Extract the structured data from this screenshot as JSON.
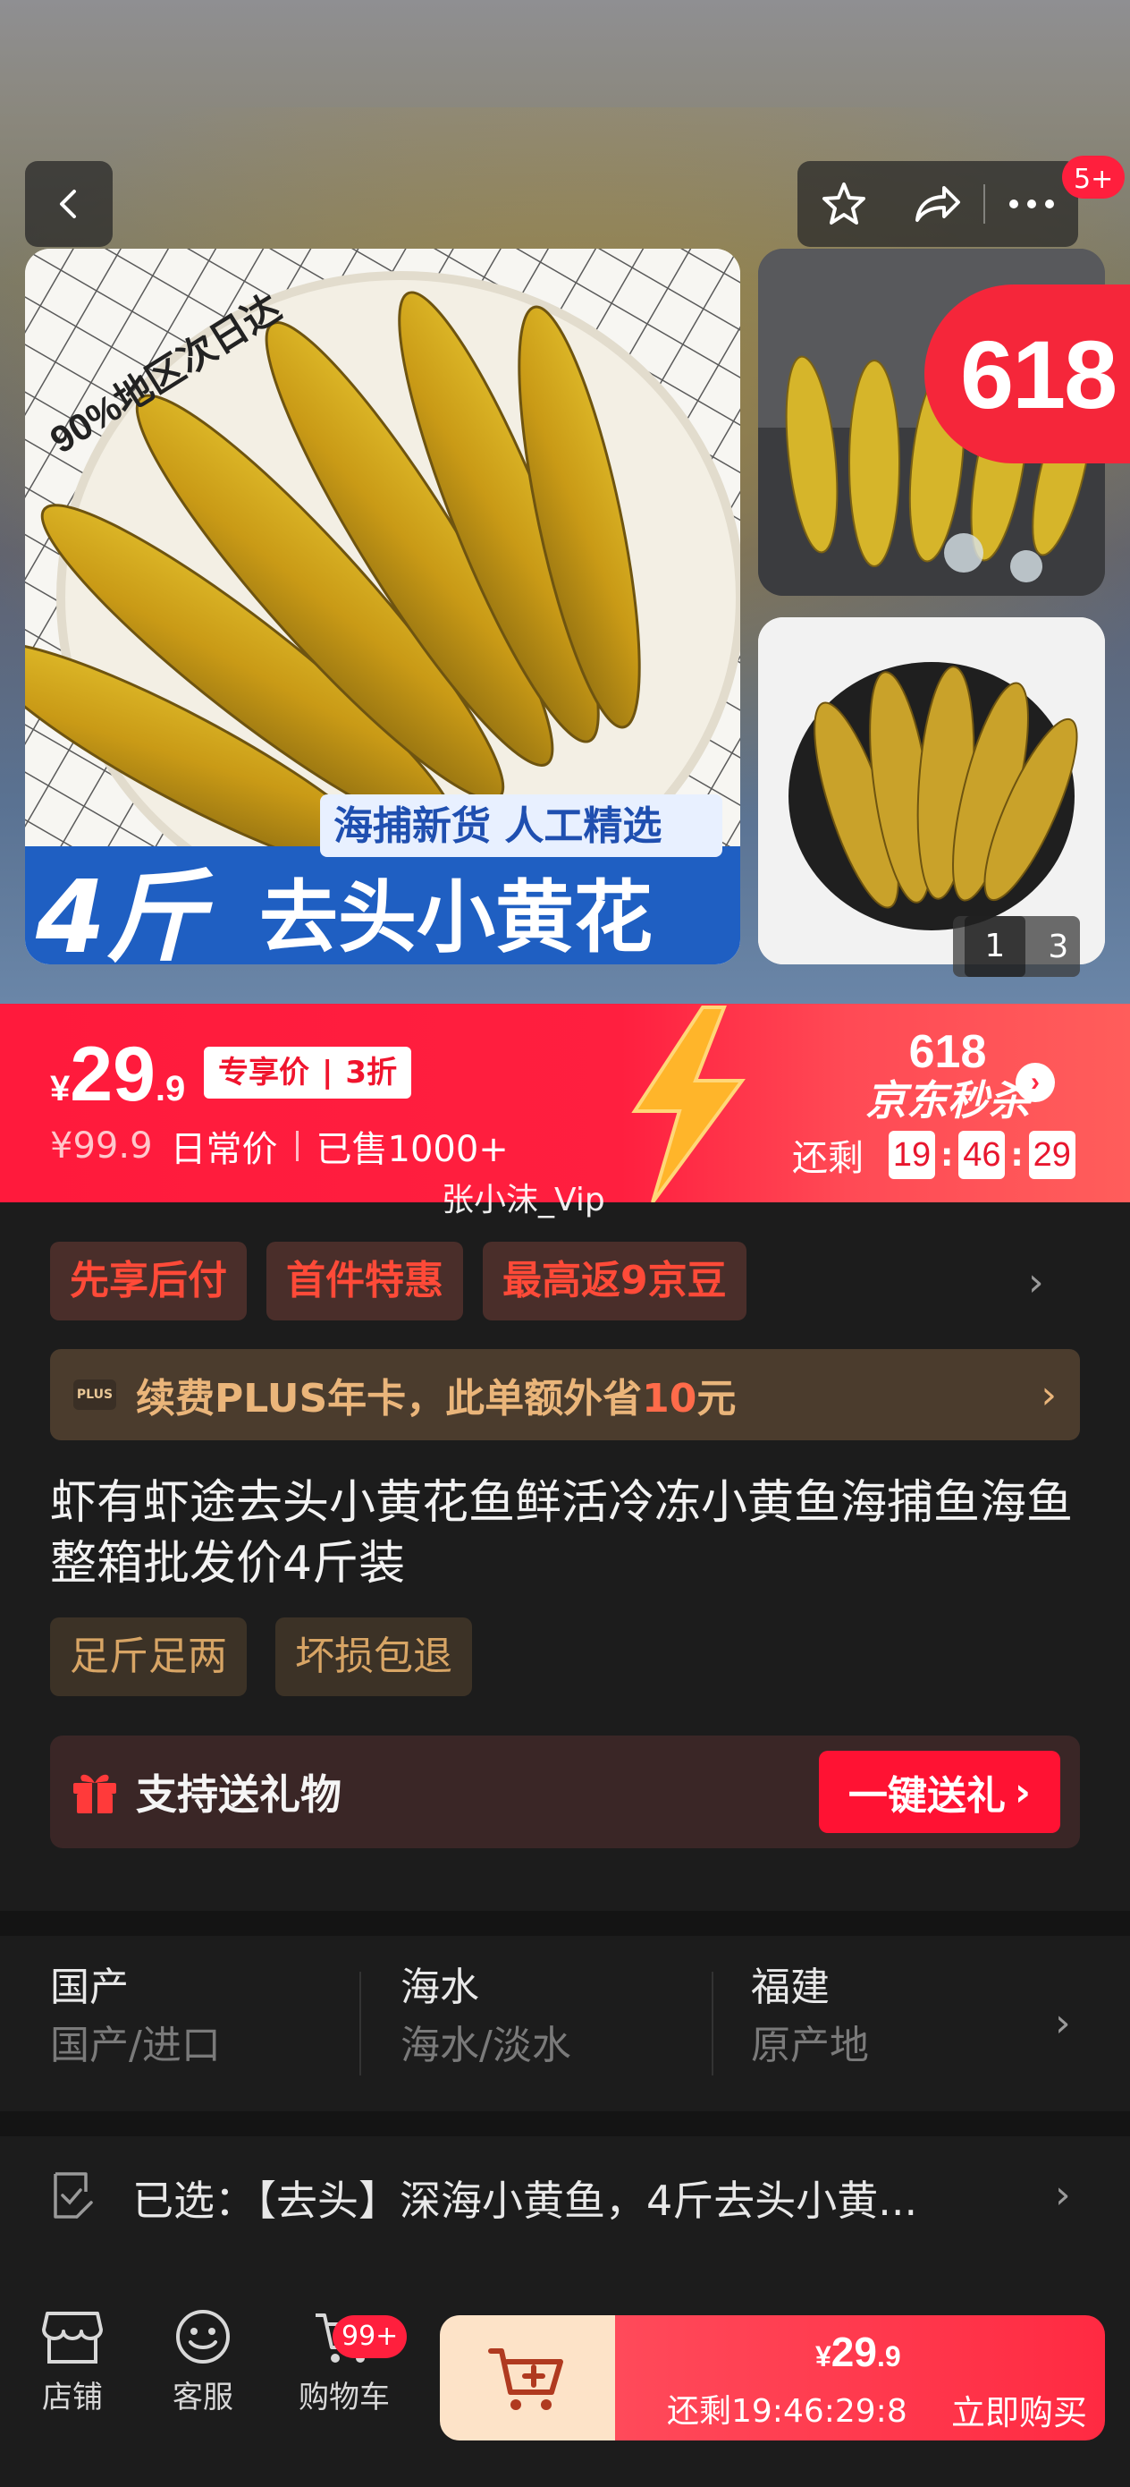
{
  "header": {
    "more_badge": "5+"
  },
  "gallery": {
    "main_image": {
      "slogan_small": "90%地区次日达",
      "banner_top": "海捕新货 人工精选",
      "banner_qty": "4斤",
      "banner_name": "去头小黄花"
    },
    "promo_badge": "618",
    "pager": {
      "current": "1",
      "total": "3"
    }
  },
  "price": {
    "symbol": "¥",
    "integer": "29",
    "decimal": ".9",
    "exclusive_label": "专享价",
    "discount": "3折",
    "original": "¥99.9",
    "original_label": "日常价",
    "sold": "已售1000+"
  },
  "seckill": {
    "line1": "618",
    "line2": "京东秒杀",
    "remaining_label": "还剩",
    "hours": "19",
    "minutes": "46",
    "seconds": "29"
  },
  "watermark": "张小沫_Vip",
  "tags": [
    "先享后付",
    "首件特惠",
    "最高返9京豆"
  ],
  "plus": {
    "logo": "PLUS",
    "text_before": "续费PLUS年卡，此单额外省",
    "amount": "10",
    "text_after": "元"
  },
  "title": "虾有虾途去头小黄花鱼鲜活冷冻小黄鱼海捕鱼海鱼整箱批发价4斤装",
  "features": [
    "足斤足两",
    "坏损包退"
  ],
  "gift": {
    "label": "支持送礼物",
    "button": "一键送礼"
  },
  "attributes": [
    {
      "value": "国产",
      "key": "国产/进口"
    },
    {
      "value": "海水",
      "key": "海水/淡水"
    },
    {
      "value": "福建",
      "key": "原产地"
    }
  ],
  "selected": {
    "text": "已选：【去头】深海小黄鱼，4斤去头小黄..."
  },
  "bottom_bar": {
    "shop": "店铺",
    "service": "客服",
    "cart": "购物车",
    "cart_badge": "99+",
    "buy_symbol": "¥",
    "buy_integer": "29",
    "buy_decimal": ".9",
    "buy_countdown": "还剩19:46:29:8",
    "buy_label": "立即购买"
  },
  "colors": {
    "accent_red": "#ff1a3c",
    "gold": "#eab57a",
    "background": "#1c1c1c"
  }
}
